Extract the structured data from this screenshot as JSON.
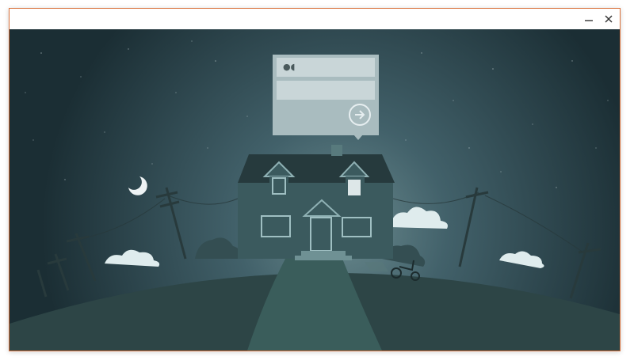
{
  "window": {
    "minimize_icon": "minimize-icon",
    "close_icon": "close-icon"
  },
  "login": {
    "username_value": "●◖",
    "password_value": "",
    "submit_icon": "arrow-right-circle-icon"
  },
  "colors": {
    "sky_top": "#1d3137",
    "sky_glow": "#5f7d82",
    "hill": "#2d4546",
    "path": "#3a5d5b",
    "house": "#3b5a5e",
    "roof": "#263a3d",
    "window_lit": "#dde7e8",
    "cloud": "#dfeced",
    "login_panel": "#a9bcbf",
    "window_border": "#d9703a"
  }
}
